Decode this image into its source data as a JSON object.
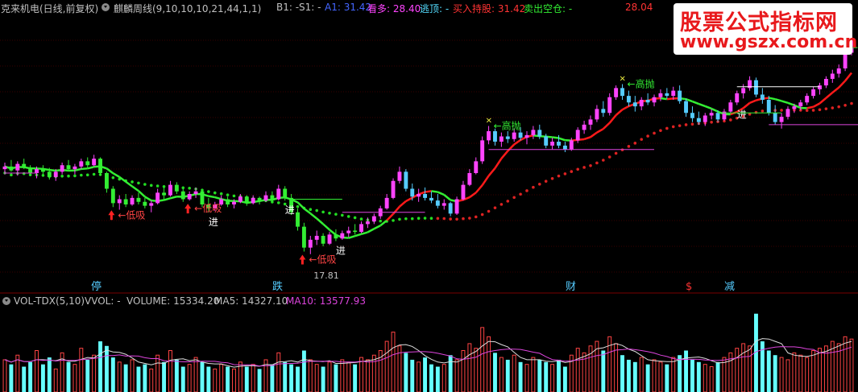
{
  "header": {
    "stock": "克来机电(日线,前复权)",
    "indicator": "麒麟周线(9,10,10,10,21,44,1,1)",
    "b1": "B1: -",
    "s1": "S1: -",
    "a1": "A1: 31.42",
    "kanduo": "看多: 28.40",
    "taoding": "逃顶: -",
    "buy_hold": "买入持股: 31.42",
    "sell_clear": "卖出空仓: -",
    "extra_value": "28.04"
  },
  "volume_header": {
    "title": "VOL-TDX(5,10)",
    "vvol": "VVOL: -",
    "volume": "VOLUME: 15334.20",
    "ma5": "MA5: 14327.10",
    "ma10": "MA10: 13577.93"
  },
  "watermark": {
    "line1": "股票公式指标网",
    "line2": "www.gszx.com.cn"
  },
  "annotations": {
    "dixi": "低吸",
    "jin": "进",
    "gaopao": "高抛",
    "low_value": "17.81"
  },
  "markers": {
    "ting": "停",
    "die": "跌",
    "cai": "财",
    "s": "$",
    "jian": "减"
  },
  "colors": {
    "background": "#000000",
    "up_candle": "#ff44ff",
    "down_candle": "#55ccff",
    "up_green": "#33ee33",
    "red_line": "#ff1a1a",
    "green_dots": "#22dd22",
    "red_dots": "#dd2222",
    "volume_up": "#ff4444",
    "volume_down": "#66ffff"
  },
  "chart_data": {
    "type": "candlestick",
    "price_range": [
      16,
      36
    ],
    "candles": [
      [
        24.3,
        24.8,
        23.9,
        24.5
      ],
      [
        24.5,
        25.0,
        24.1,
        24.2
      ],
      [
        24.2,
        24.9,
        23.8,
        24.7
      ],
      [
        24.7,
        25.1,
        24.3,
        24.4
      ],
      [
        24.4,
        24.6,
        23.8,
        24.0
      ],
      [
        24.0,
        24.5,
        23.6,
        24.3
      ],
      [
        24.3,
        24.6,
        23.9,
        24.1
      ],
      [
        24.1,
        24.4,
        23.5,
        23.7
      ],
      [
        23.7,
        24.3,
        23.4,
        24.1
      ],
      [
        24.1,
        24.8,
        23.9,
        24.6
      ],
      [
        24.6,
        25.0,
        24.2,
        24.3
      ],
      [
        24.3,
        24.7,
        23.9,
        24.5
      ],
      [
        24.5,
        25.1,
        24.3,
        24.9
      ],
      [
        24.9,
        25.2,
        24.4,
        24.6
      ],
      [
        24.6,
        25.4,
        24.5,
        25.1
      ],
      [
        25.1,
        25.2,
        23.8,
        24.0
      ],
      [
        24.0,
        24.1,
        22.5,
        22.8
      ],
      [
        22.8,
        23.0,
        21.4,
        21.7
      ],
      [
        21.7,
        22.3,
        21.2,
        22.0
      ],
      [
        22.0,
        22.4,
        21.4,
        21.6
      ],
      [
        21.6,
        22.3,
        21.5,
        22.1
      ],
      [
        22.1,
        22.5,
        21.6,
        21.8
      ],
      [
        21.8,
        22.1,
        21.3,
        21.5
      ],
      [
        21.5,
        21.9,
        21.0,
        21.7
      ],
      [
        21.7,
        22.8,
        21.6,
        22.5
      ],
      [
        22.5,
        22.9,
        22.0,
        22.3
      ],
      [
        22.3,
        23.4,
        22.2,
        23.1
      ],
      [
        23.1,
        23.3,
        22.4,
        22.6
      ],
      [
        22.6,
        22.8,
        21.8,
        22.0
      ],
      [
        22.0,
        22.6,
        21.9,
        22.4
      ],
      [
        22.4,
        22.9,
        22.1,
        22.6
      ],
      [
        22.6,
        22.7,
        21.4,
        21.6
      ],
      [
        21.6,
        22.1,
        21.0,
        21.3
      ],
      [
        21.3,
        21.8,
        21.1,
        21.6
      ],
      [
        21.6,
        22.3,
        21.5,
        22.0
      ],
      [
        22.0,
        22.2,
        21.4,
        21.6
      ],
      [
        21.6,
        22.0,
        21.3,
        21.8
      ],
      [
        21.8,
        22.4,
        21.7,
        22.2
      ],
      [
        22.2,
        22.3,
        21.5,
        21.7
      ],
      [
        21.7,
        22.3,
        21.6,
        22.1
      ],
      [
        22.1,
        22.2,
        21.6,
        21.9
      ],
      [
        21.9,
        22.6,
        21.8,
        22.3
      ],
      [
        22.3,
        22.6,
        21.8,
        22.0
      ],
      [
        22.0,
        23.1,
        21.9,
        22.8
      ],
      [
        22.8,
        23.0,
        21.9,
        22.1
      ],
      [
        22.1,
        22.4,
        20.8,
        21.0
      ],
      [
        21.0,
        21.3,
        19.6,
        19.9
      ],
      [
        19.9,
        20.2,
        18.0,
        18.3
      ],
      [
        18.3,
        19.2,
        17.8,
        18.9
      ],
      [
        18.9,
        19.6,
        18.5,
        19.2
      ],
      [
        19.2,
        19.4,
        18.4,
        18.6
      ],
      [
        18.6,
        19.5,
        18.5,
        19.3
      ],
      [
        19.3,
        19.7,
        18.8,
        19.0
      ],
      [
        19.0,
        19.6,
        18.9,
        19.4
      ],
      [
        19.4,
        19.9,
        19.1,
        19.6
      ],
      [
        19.6,
        20.1,
        19.3,
        19.5
      ],
      [
        19.5,
        20.3,
        19.4,
        20.1
      ],
      [
        20.1,
        20.6,
        19.8,
        20.3
      ],
      [
        20.3,
        20.9,
        20.1,
        20.7
      ],
      [
        20.7,
        21.5,
        20.5,
        21.3
      ],
      [
        21.3,
        22.4,
        21.2,
        22.1
      ],
      [
        22.1,
        23.6,
        22.0,
        23.4
      ],
      [
        23.4,
        24.5,
        23.2,
        24.1
      ],
      [
        24.1,
        24.3,
        22.6,
        22.8
      ],
      [
        22.8,
        23.2,
        21.9,
        22.2
      ],
      [
        22.2,
        22.8,
        21.8,
        22.4
      ],
      [
        22.4,
        22.9,
        21.9,
        22.1
      ],
      [
        22.1,
        22.6,
        21.7,
        21.9
      ],
      [
        21.9,
        22.4,
        21.3,
        21.5
      ],
      [
        21.5,
        22.0,
        21.2,
        21.7
      ],
      [
        21.7,
        21.8,
        20.7,
        20.9
      ],
      [
        20.9,
        22.2,
        20.8,
        22.0
      ],
      [
        22.0,
        23.4,
        21.9,
        23.1
      ],
      [
        23.1,
        24.3,
        23.0,
        24.0
      ],
      [
        24.0,
        25.2,
        23.9,
        24.9
      ],
      [
        24.9,
        26.8,
        24.7,
        26.5
      ],
      [
        26.5,
        27.6,
        26.2,
        27.2
      ],
      [
        27.2,
        27.4,
        26.1,
        26.4
      ],
      [
        26.4,
        27.1,
        26.0,
        26.8
      ],
      [
        26.8,
        27.2,
        26.3,
        26.6
      ],
      [
        26.6,
        27.4,
        26.4,
        27.1
      ],
      [
        27.1,
        27.5,
        26.5,
        26.7
      ],
      [
        26.7,
        27.2,
        26.2,
        26.9
      ],
      [
        26.9,
        27.6,
        26.6,
        27.3
      ],
      [
        27.3,
        27.7,
        26.6,
        26.8
      ],
      [
        26.8,
        27.0,
        25.9,
        26.1
      ],
      [
        26.1,
        26.7,
        25.8,
        26.4
      ],
      [
        26.4,
        26.9,
        25.9,
        26.1
      ],
      [
        26.1,
        26.4,
        25.6,
        25.8
      ],
      [
        25.8,
        26.7,
        25.7,
        26.5
      ],
      [
        26.5,
        27.5,
        26.3,
        27.3
      ],
      [
        27.3,
        28.0,
        27.0,
        27.7
      ],
      [
        27.7,
        28.4,
        27.3,
        28.1
      ],
      [
        28.1,
        29.2,
        27.9,
        28.9
      ],
      [
        28.9,
        29.5,
        28.3,
        28.6
      ],
      [
        28.6,
        30.1,
        28.4,
        29.8
      ],
      [
        29.8,
        30.7,
        29.6,
        30.5
      ],
      [
        30.5,
        30.8,
        29.6,
        29.9
      ],
      [
        29.9,
        30.3,
        29.1,
        29.4
      ],
      [
        29.4,
        29.9,
        28.7,
        29.1
      ],
      [
        29.1,
        29.8,
        28.8,
        29.6
      ],
      [
        29.6,
        30.1,
        29.2,
        29.4
      ],
      [
        29.4,
        30.0,
        29.1,
        29.8
      ],
      [
        29.8,
        30.4,
        29.5,
        30.1
      ],
      [
        30.1,
        30.5,
        29.7,
        29.9
      ],
      [
        29.9,
        30.6,
        29.6,
        30.3
      ],
      [
        30.3,
        30.7,
        29.3,
        29.5
      ],
      [
        29.5,
        29.7,
        28.3,
        28.6
      ],
      [
        28.6,
        29.1,
        27.9,
        28.2
      ],
      [
        28.2,
        28.7,
        27.7,
        27.9
      ],
      [
        27.9,
        28.6,
        27.6,
        28.4
      ],
      [
        28.4,
        28.9,
        28.1,
        28.6
      ],
      [
        28.6,
        28.8,
        27.9,
        28.1
      ],
      [
        28.1,
        28.9,
        28.0,
        28.7
      ],
      [
        28.7,
        29.6,
        28.6,
        29.4
      ],
      [
        29.4,
        30.3,
        29.2,
        30.1
      ],
      [
        30.1,
        30.8,
        29.7,
        30.5
      ],
      [
        30.5,
        31.4,
        30.3,
        31.1
      ],
      [
        31.1,
        31.3,
        29.8,
        30.0
      ],
      [
        30.0,
        30.5,
        29.3,
        29.6
      ],
      [
        29.6,
        29.9,
        28.4,
        28.6
      ],
      [
        28.6,
        29.2,
        27.7,
        27.9
      ],
      [
        27.9,
        28.6,
        27.4,
        28.3
      ],
      [
        28.3,
        29.1,
        28.1,
        28.9
      ],
      [
        28.9,
        29.3,
        28.6,
        29.1
      ],
      [
        29.1,
        29.6,
        28.8,
        29.4
      ],
      [
        29.4,
        30.1,
        29.2,
        29.9
      ],
      [
        29.9,
        30.6,
        29.7,
        30.4
      ],
      [
        30.4,
        30.9,
        30.0,
        30.7
      ],
      [
        30.7,
        31.4,
        30.5,
        31.2
      ],
      [
        31.2,
        31.9,
        30.9,
        31.6
      ],
      [
        31.6,
        32.3,
        31.3,
        32.0
      ],
      [
        32.0,
        33.6,
        31.8,
        33.2
      ],
      [
        33.2,
        34.6,
        33.0,
        34.3
      ]
    ],
    "volumes": [
      14,
      12,
      16,
      11,
      13,
      18,
      12,
      15,
      10,
      17,
      13,
      12,
      19,
      14,
      16,
      22,
      20,
      15,
      13,
      12,
      14,
      11,
      12,
      10,
      16,
      13,
      18,
      14,
      11,
      12,
      15,
      13,
      11,
      10,
      12,
      11,
      10,
      13,
      11,
      12,
      10,
      14,
      12,
      17,
      13,
      12,
      11,
      18,
      14,
      12,
      11,
      13,
      12,
      14,
      13,
      12,
      15,
      14,
      16,
      18,
      22,
      26,
      20,
      17,
      14,
      13,
      15,
      12,
      11,
      12,
      16,
      14,
      18,
      21,
      19,
      28,
      24,
      17,
      15,
      14,
      16,
      13,
      12,
      15,
      14,
      13,
      12,
      14,
      11,
      16,
      19,
      17,
      20,
      22,
      18,
      24,
      21,
      16,
      14,
      13,
      15,
      12,
      14,
      13,
      12,
      15,
      16,
      18,
      14,
      13,
      12,
      11,
      13,
      15,
      17,
      19,
      21,
      20,
      34,
      22,
      18,
      16,
      15,
      14,
      17,
      16,
      15,
      18,
      19,
      20,
      22,
      21,
      24,
      23
    ],
    "volume_range": [
      0,
      36
    ]
  }
}
